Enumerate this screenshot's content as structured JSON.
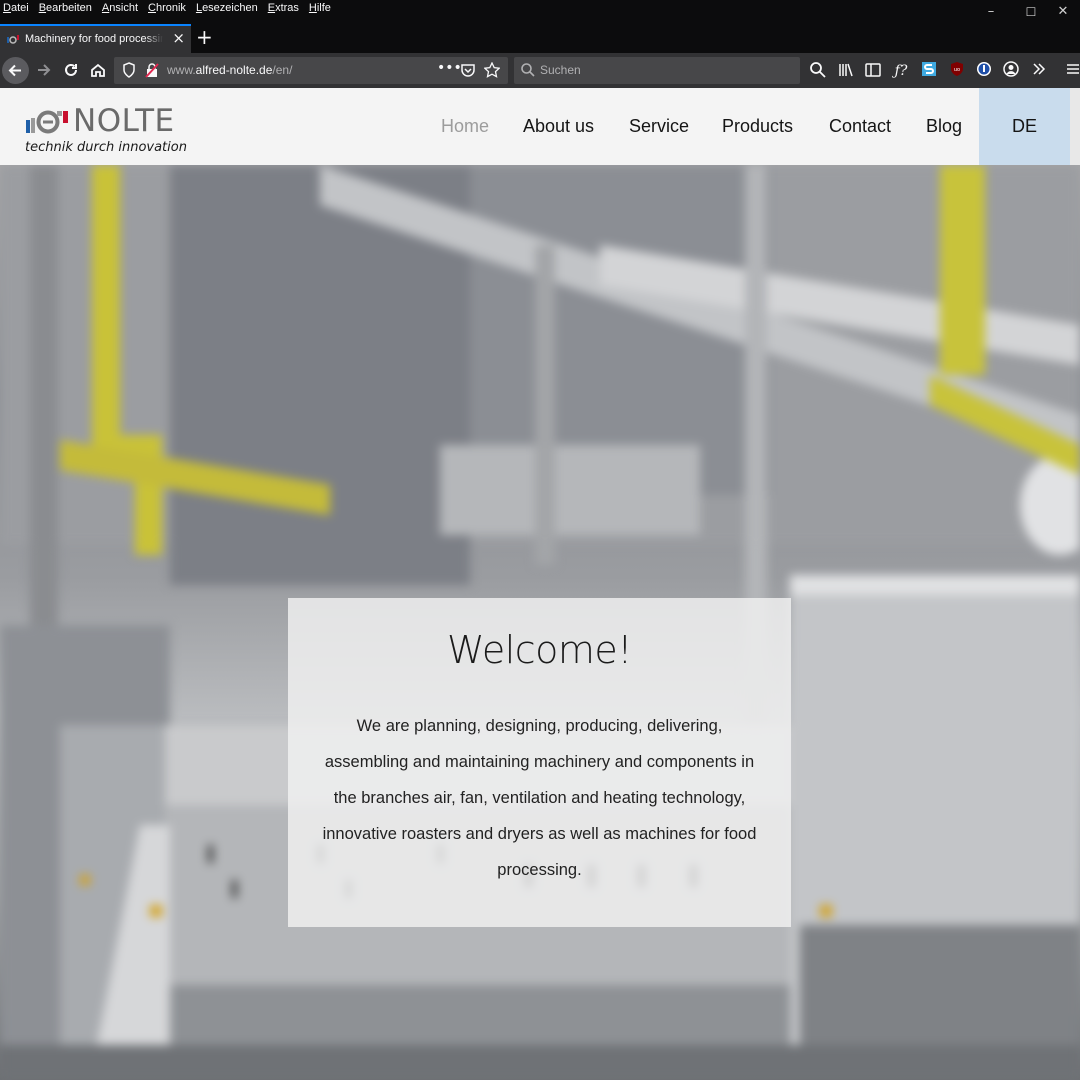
{
  "browser": {
    "menu": [
      "Datei",
      "Bearbeiten",
      "Ansicht",
      "Chronik",
      "Lesezeichen",
      "Extras",
      "Hilfe"
    ],
    "tab_title": "Machinery for food processing",
    "url_prefix": "www.",
    "url_host": "alfred-nolte.de",
    "url_path": "/en/",
    "search_placeholder": "Suchen",
    "window_controls": {
      "minimize": "–",
      "maximize": "☐",
      "close": "✕"
    }
  },
  "site": {
    "logo": {
      "word": "NOLTE",
      "tagline": "technik durch innovation",
      "colors": {
        "blue": "#1f5fa8",
        "red": "#c8102e",
        "grey": "#6a6a6a"
      }
    },
    "nav": [
      {
        "label": "Home",
        "active": true
      },
      {
        "label": "About us"
      },
      {
        "label": "Service"
      },
      {
        "label": "Products"
      },
      {
        "label": "Contact"
      },
      {
        "label": "Blog"
      }
    ],
    "lang": "DE",
    "lang_bg": "#c9dced",
    "welcome": {
      "title": "Welcome!",
      "text": "We are planning, designing, producing, delivering, assembling and maintaining machinery and components in the branches air, fan, ventilation and heating technology, innovative roasters and dryers as well as machines for food processing."
    }
  }
}
